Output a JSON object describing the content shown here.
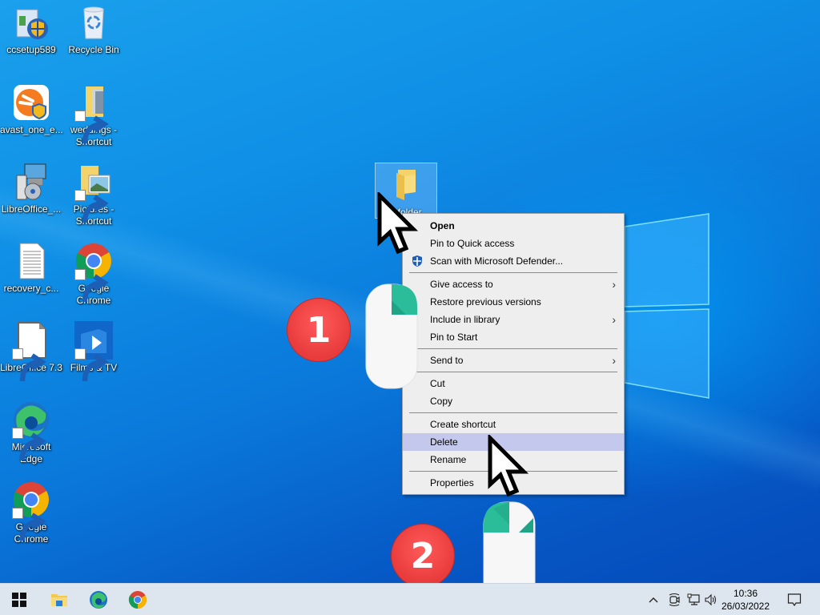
{
  "desktop": {
    "icons": [
      {
        "label": "ccsetup589",
        "icon": "ccleaner-setup-icon"
      },
      {
        "label": "Recycle Bin",
        "icon": "recycle-bin-icon"
      },
      {
        "label": "avast_one_e...",
        "icon": "avast-icon"
      },
      {
        "label": "weddings - Shortcut",
        "icon": "folder-shortcut-icon"
      },
      {
        "label": "LibreOffice_...",
        "icon": "installer-icon"
      },
      {
        "label": "Pictures - Shortcut",
        "icon": "pictures-folder-icon"
      },
      {
        "label": "recovery_c...",
        "icon": "text-document-icon"
      },
      {
        "label": "Google Chrome",
        "icon": "chrome-icon"
      },
      {
        "label": "LibreOffice 7.3",
        "icon": "libreoffice-icon"
      },
      {
        "label": "Films & TV",
        "icon": "films-tv-icon"
      },
      {
        "label": "Microsoft Edge",
        "icon": "edge-icon"
      },
      {
        "label": "Google Chrome",
        "icon": "chrome-icon"
      }
    ],
    "selected_folder": {
      "label": "New folder",
      "visible_label": "y folder"
    }
  },
  "context_menu": {
    "items": [
      {
        "label": "Open",
        "bold": true
      },
      {
        "label": "Pin to Quick access"
      },
      {
        "label": "Scan with Microsoft Defender...",
        "icon": "defender-shield-icon"
      },
      {
        "separator": true
      },
      {
        "label": "Give access to",
        "submenu": true
      },
      {
        "label": "Restore previous versions"
      },
      {
        "label": "Include in library",
        "submenu": true
      },
      {
        "label": "Pin to Start"
      },
      {
        "separator": true
      },
      {
        "label": "Send to",
        "submenu": true
      },
      {
        "separator": true
      },
      {
        "label": "Cut"
      },
      {
        "label": "Copy"
      },
      {
        "separator": true
      },
      {
        "label": "Create shortcut"
      },
      {
        "label": "Delete",
        "highlighted": true
      },
      {
        "label": "Rename"
      },
      {
        "separator": true
      },
      {
        "label": "Properties"
      }
    ],
    "submenu_arrow": "›",
    "highlight_color": "#c4c8ec"
  },
  "annotations": {
    "step1": "1",
    "step2": "2",
    "step1_action": "right-click",
    "step2_action": "left-click",
    "badge_color": "#e83b3b",
    "mouse_button_color": "#2bbd9a"
  },
  "taskbar": {
    "pinned": [
      "start-button",
      "file-explorer",
      "microsoft-edge",
      "google-chrome"
    ],
    "tray": [
      "show-hidden-icons",
      "meet-now",
      "network",
      "volume"
    ],
    "time": "10:36",
    "date": "26/03/2022"
  }
}
